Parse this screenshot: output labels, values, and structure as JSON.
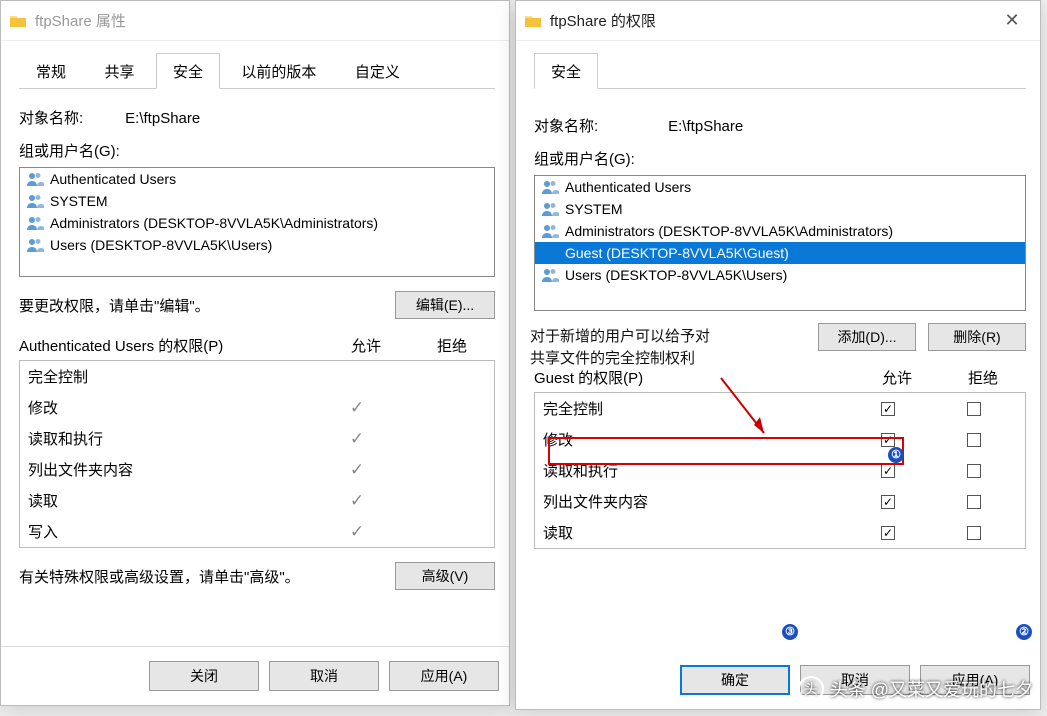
{
  "left_dialog": {
    "title": "ftpShare 属性",
    "tabs": [
      "常规",
      "共享",
      "安全",
      "以前的版本",
      "自定义"
    ],
    "active_tab": 2,
    "object_label": "对象名称:",
    "object_path": "E:\\ftpShare",
    "groups_label": "组或用户名(G):",
    "groups": [
      {
        "label": "Authenticated Users",
        "type": "multi"
      },
      {
        "label": "SYSTEM",
        "type": "multi"
      },
      {
        "label": "Administrators (DESKTOP-8VVLA5K\\Administrators)",
        "type": "multi"
      },
      {
        "label": "Users (DESKTOP-8VVLA5K\\Users)",
        "type": "multi"
      }
    ],
    "edit_hint": "要更改权限，请单击\"编辑\"。",
    "edit_btn": "编辑(E)...",
    "perm_label": "Authenticated Users 的权限(P)",
    "allow": "允许",
    "deny": "拒绝",
    "perms": [
      {
        "name": "完全控制",
        "allow": false
      },
      {
        "name": "修改",
        "allow": true
      },
      {
        "name": "读取和执行",
        "allow": true
      },
      {
        "name": "列出文件夹内容",
        "allow": true
      },
      {
        "name": "读取",
        "allow": true
      },
      {
        "name": "写入",
        "allow": true
      }
    ],
    "adv_hint": "有关特殊权限或高级设置，请单击\"高级\"。",
    "adv_btn": "高级(V)",
    "close_btn": "关闭",
    "cancel_btn": "取消",
    "apply_btn": "应用(A)"
  },
  "right_dialog": {
    "title": "ftpShare 的权限",
    "tab": "安全",
    "object_label": "对象名称:",
    "object_path": "E:\\ftpShare",
    "groups_label": "组或用户名(G):",
    "groups": [
      {
        "label": "Authenticated Users",
        "selected": false,
        "type": "multi"
      },
      {
        "label": "SYSTEM",
        "selected": false,
        "type": "multi"
      },
      {
        "label": "Administrators (DESKTOP-8VVLA5K\\Administrators)",
        "selected": false,
        "type": "multi"
      },
      {
        "label": "Guest (DESKTOP-8VVLA5K\\Guest)",
        "selected": true,
        "type": "solo"
      },
      {
        "label": "Users (DESKTOP-8VVLA5K\\Users)",
        "selected": false,
        "type": "multi"
      }
    ],
    "add_btn": "添加(D)...",
    "remove_btn": "删除(R)",
    "perm_label": "Guest 的权限(P)",
    "allow": "允许",
    "deny": "拒绝",
    "perms": [
      {
        "name": "完全控制",
        "allow": true,
        "deny": false
      },
      {
        "name": "修改",
        "allow": true,
        "deny": false
      },
      {
        "name": "读取和执行",
        "allow": true,
        "deny": false
      },
      {
        "name": "列出文件夹内容",
        "allow": true,
        "deny": false
      },
      {
        "name": "读取",
        "allow": true,
        "deny": false
      }
    ],
    "ok_btn": "确定",
    "cancel_btn": "取消",
    "apply_btn": "应用(A)"
  },
  "annotation": {
    "text": "对于新增的用户可以给予对\n共享文件的完全控制权利",
    "circles": [
      "①",
      "②",
      "③"
    ]
  },
  "watermark": "头条 @又菜又爱玩的七夕"
}
